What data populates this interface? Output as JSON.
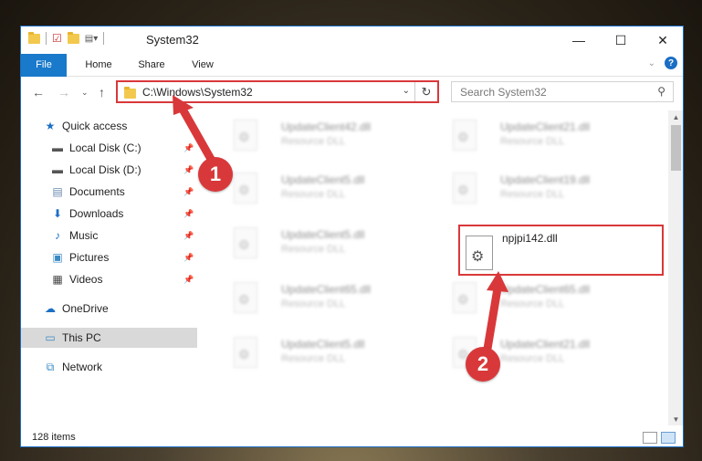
{
  "window": {
    "title": "System32"
  },
  "ribbon": {
    "tabs": [
      "File",
      "Home",
      "Share",
      "View"
    ]
  },
  "nav": {
    "address": "C:\\Windows\\System32",
    "search_placeholder": "Search System32"
  },
  "sidebar": {
    "items": [
      {
        "label": "Quick access",
        "icon": "star-icon"
      },
      {
        "label": "Local Disk (C:)",
        "icon": "drive-icon"
      },
      {
        "label": "Local Disk (D:)",
        "icon": "drive-icon"
      },
      {
        "label": "Documents",
        "icon": "documents-icon"
      },
      {
        "label": "Downloads",
        "icon": "download-icon"
      },
      {
        "label": "Music",
        "icon": "music-icon"
      },
      {
        "label": "Pictures",
        "icon": "pictures-icon"
      },
      {
        "label": "Videos",
        "icon": "videos-icon"
      },
      {
        "label": "OneDrive",
        "icon": "cloud-icon"
      },
      {
        "label": "This PC",
        "icon": "computer-icon"
      },
      {
        "label": "Network",
        "icon": "network-icon"
      }
    ]
  },
  "files": [
    {
      "name": "UpdateClient42.dll",
      "type": "Resource DLL"
    },
    {
      "name": "UpdateClient21.dll",
      "type": "Resource DLL"
    },
    {
      "name": "UpdateClient5.dll",
      "type": "Resource DLL"
    },
    {
      "name": "UpdateClient19.dll",
      "type": "Resource DLL"
    },
    {
      "name": "UpdateClient5.dll",
      "type": "Resource DLL"
    },
    {
      "name": "npjpi142.dll",
      "type": ""
    },
    {
      "name": "UpdateClient65.dll",
      "type": "Resource DLL"
    },
    {
      "name": "UpdateClient65.dll",
      "type": "Resource DLL"
    },
    {
      "name": "UpdateClient5.dll",
      "type": "Resource DLL"
    },
    {
      "name": "UpdateClient21.dll",
      "type": "Resource DLL"
    }
  ],
  "status": {
    "items_count": "128 items"
  },
  "annotations": {
    "step1": "1",
    "step2": "2",
    "color": "#d9383a"
  }
}
